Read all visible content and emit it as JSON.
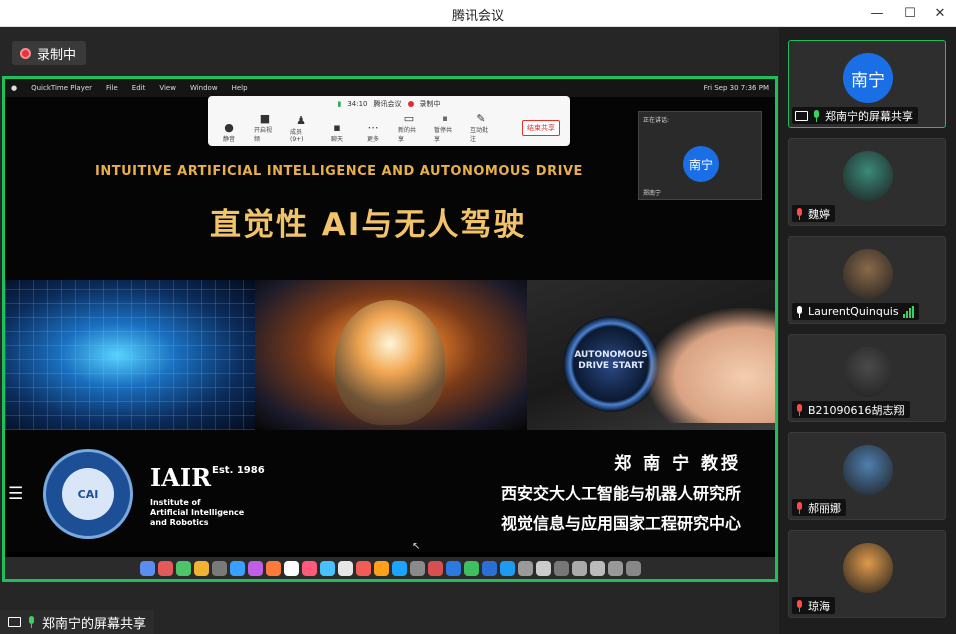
{
  "window": {
    "title": "腾讯会议",
    "minimize": "—",
    "maximize": "☐",
    "close": "✕"
  },
  "recording": {
    "label": "录制中"
  },
  "mac_menu": {
    "apps": [
      "QuickTime Player",
      "File",
      "Edit",
      "View",
      "Window",
      "Help"
    ],
    "clock": "Fri Sep 30  7:36 PM"
  },
  "meeting_toolbar": {
    "timer": "34:10",
    "app_name": "腾讯会议",
    "rec_label": "录制中",
    "items": [
      "静音",
      "开启视频",
      "成员(9+)",
      "聊天",
      "更多",
      "新的共享",
      "暂停共享",
      "互动批注"
    ],
    "end_share": "结束共享"
  },
  "speaker_panel": {
    "header": "正在讲话:",
    "avatar_text": "南宁",
    "name": "郑南宁"
  },
  "slide": {
    "title_en": "INTUITIVE ARTIFICIAL INTELLIGENCE AND AUTONOMOUS DRIVE",
    "title_cn": "直觉性 AI与无人驾驶",
    "button_text": "AUTONOMOUS DRIVE START",
    "logo_text": "CAI",
    "iair": "IAIR",
    "iair_est": "Est. 1986",
    "iair_sub1": "Institute of",
    "iair_sub2": "Artificial Intelligence",
    "iair_sub3": "and Robotics",
    "prof_line1": "郑 南 宁  教授",
    "prof_line2": "西安交大人工智能与机器人研究所",
    "prof_line3": "视觉信息与应用国家工程研究中心"
  },
  "share_label": "郑南宁的屏幕共享",
  "participants": [
    {
      "name": "郑南宁的屏幕共享",
      "avatar_text": "南宁",
      "mic": "green",
      "active": true,
      "avatar_color": "#1b6fe6"
    },
    {
      "name": "魏婷",
      "avatar_text": "",
      "mic": "muted",
      "active": false,
      "avatar_color": "#3a8a7a"
    },
    {
      "name": "LaurentQuinquis",
      "avatar_text": "",
      "mic": "on",
      "active": false,
      "avatar_color": "#8a6a4a"
    },
    {
      "name": "B21090616胡志翔",
      "avatar_text": "",
      "mic": "muted",
      "active": false,
      "avatar_color": "#4a4a4a"
    },
    {
      "name": "郝丽娜",
      "avatar_text": "",
      "mic": "muted",
      "active": false,
      "avatar_color": "#4f7fb0"
    },
    {
      "name": "琼海",
      "avatar_text": "",
      "mic": "muted",
      "active": false,
      "avatar_color": "#e09a4a"
    }
  ]
}
